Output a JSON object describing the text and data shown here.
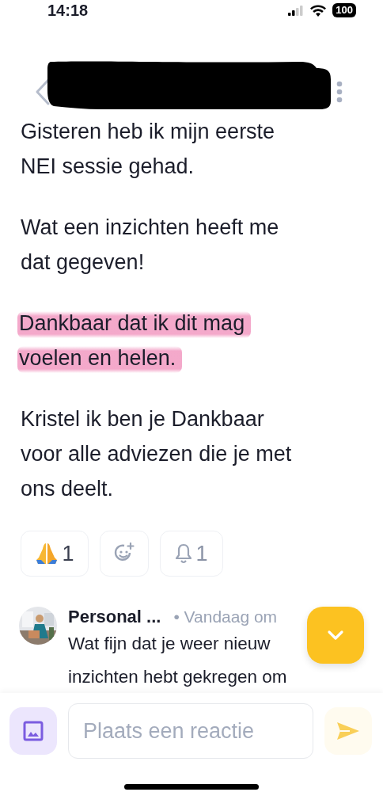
{
  "status_bar": {
    "time": "14:18",
    "battery": "100"
  },
  "post": {
    "paragraphs": [
      {
        "text": "Gisteren heb ik mijn eerste\nNEI sessie gehad.",
        "highlighted": false
      },
      {
        "text": "Wat een inzichten heeft me\ndat gegeven!",
        "highlighted": false
      },
      {
        "text": "Dankbaar dat ik dit mag\nvoelen en helen.",
        "highlighted": true
      },
      {
        "text": "Kristel ik ben je Dankbaar\nvoor alle adviezen die je met\nons deelt.",
        "highlighted": false
      }
    ]
  },
  "reactions": [
    {
      "kind": "pray",
      "count": "1"
    },
    {
      "kind": "add"
    },
    {
      "kind": "bell",
      "count": "1"
    }
  ],
  "comment": {
    "author": "Personal ...",
    "meta": "• Vandaag om",
    "lines": [
      "Wat fijn dat je weer nieuw",
      "inzichten hebt gekregen om"
    ]
  },
  "composer": {
    "placeholder": "Plaats een reactie"
  }
}
